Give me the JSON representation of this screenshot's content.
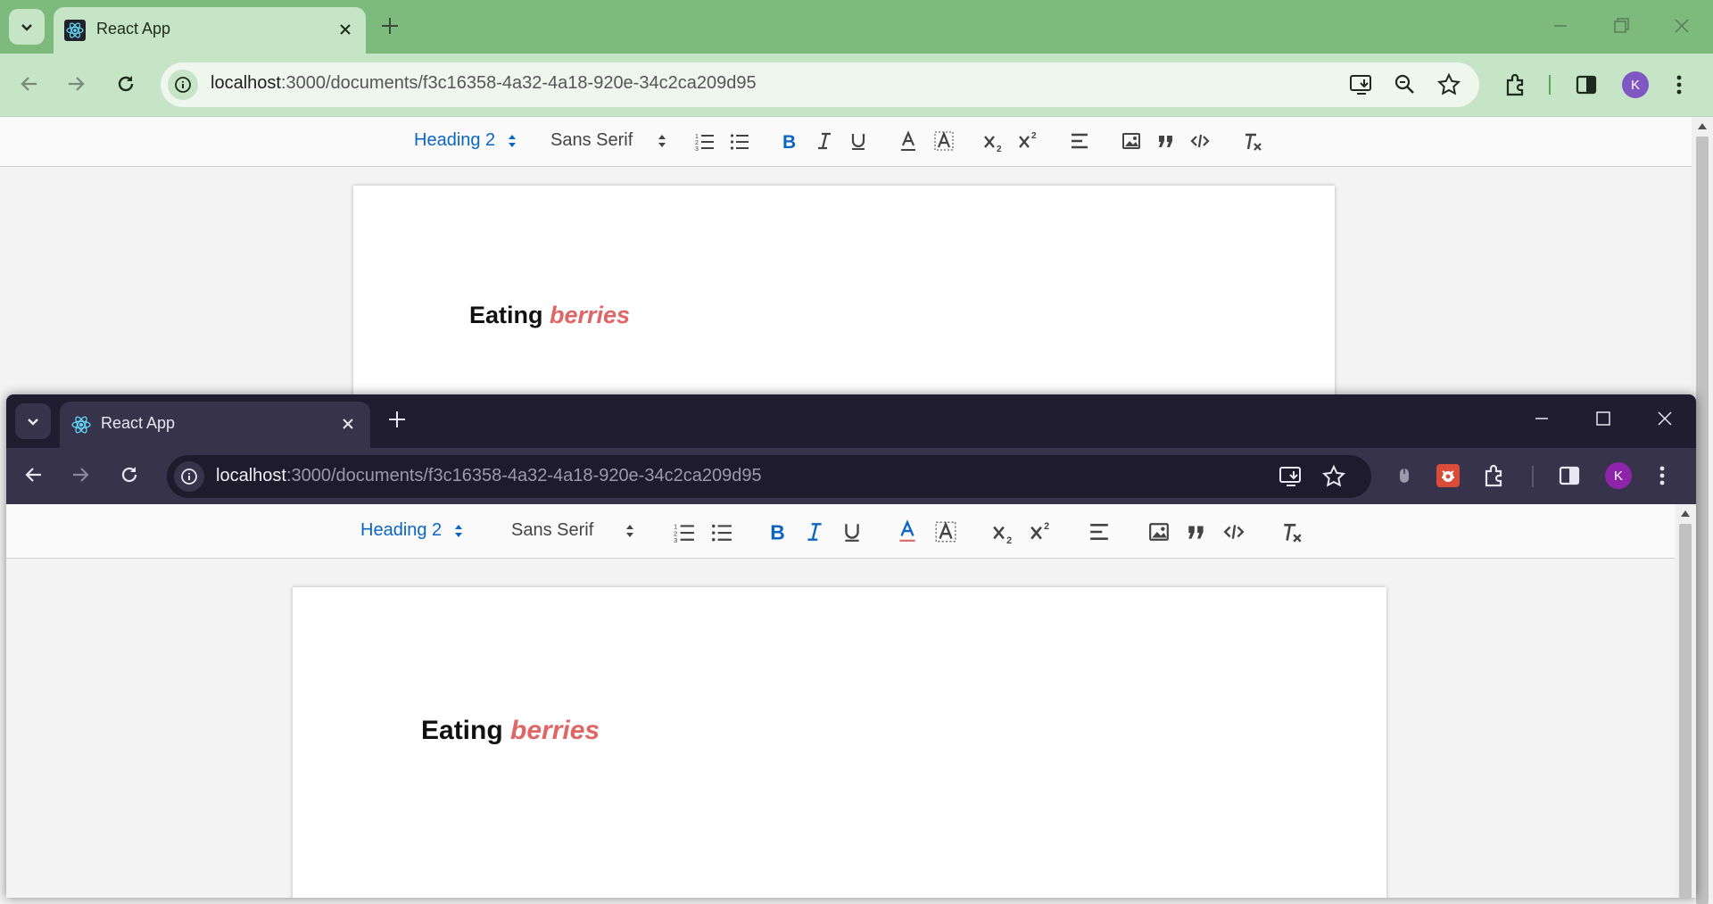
{
  "colors": {
    "back_frame": "#7dbb7d",
    "back_toolbar": "#c6e4c6",
    "front_frame": "#201d30",
    "front_toolbar": "#37334a",
    "active_blue": "#0b66c3",
    "accent_red": "#e06666",
    "avatar_purple": "#7e57c2"
  },
  "back_window": {
    "tab": {
      "title": "React App",
      "favicon": "react-logo-icon"
    },
    "address": {
      "host": "localhost",
      "path": ":3000/documents/f3c16358-4a32-4a18-920e-34c2ca209d95"
    },
    "profile_initial": "K",
    "editor_toolbar": {
      "header_picker": "Heading 2",
      "font_picker": "Sans Serif"
    },
    "document": {
      "heading_plain": "Eating ",
      "heading_colored": "berries"
    }
  },
  "front_window": {
    "tab": {
      "title": "React App",
      "favicon": "react-logo-icon"
    },
    "address": {
      "host": "localhost",
      "path": ":3000/documents/f3c16358-4a32-4a18-920e-34c2ca209d95"
    },
    "profile_initial": "K",
    "editor_toolbar": {
      "header_picker": "Heading 2",
      "font_picker": "Sans Serif"
    },
    "document": {
      "heading_plain": "Eating ",
      "heading_colored": "berries"
    }
  }
}
